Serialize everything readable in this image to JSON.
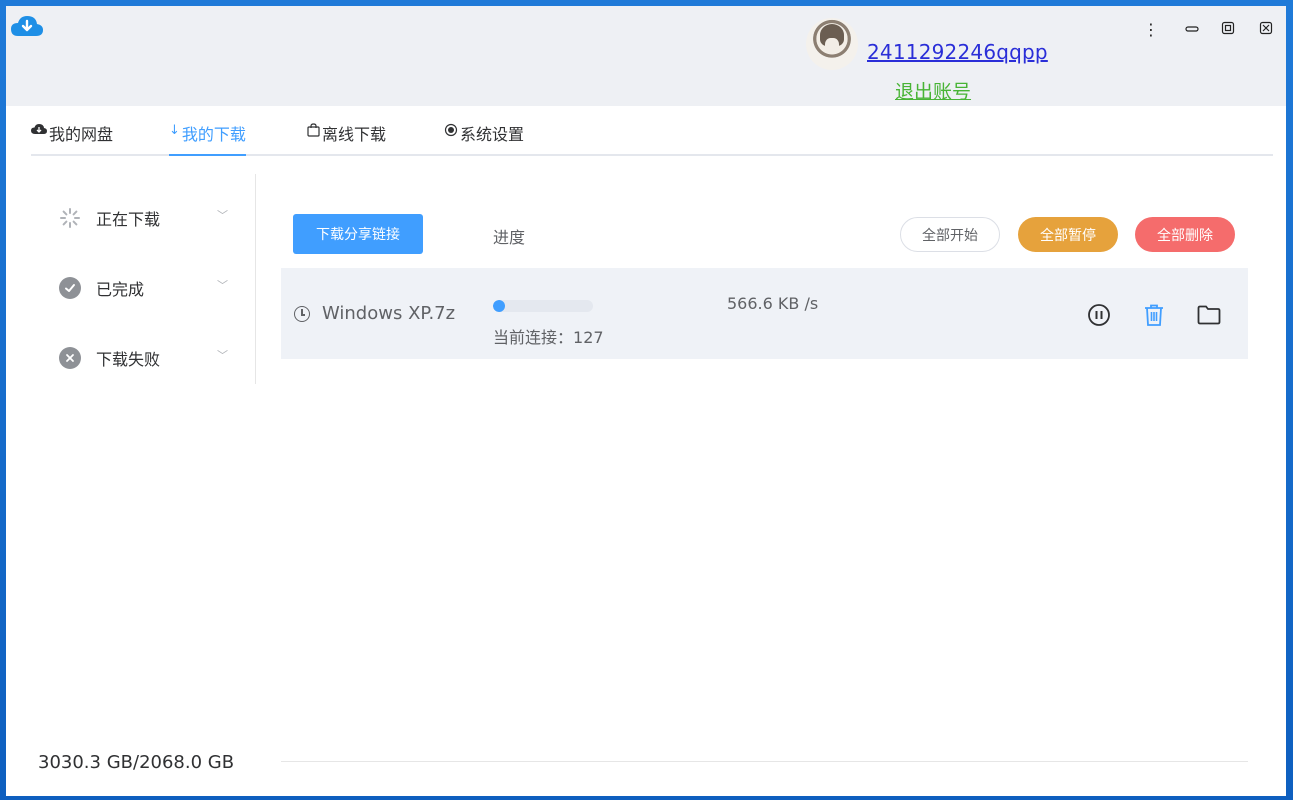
{
  "titlebar": {
    "username": "2411292246qqpp",
    "logout_label": "退出账号",
    "menu_glyph": "⋮",
    "minimize_glyph": "▭",
    "maximize_glyph": "◙",
    "close_glyph": "⛝"
  },
  "tabs": [
    {
      "icon": "cloud-icon",
      "label": "我的网盘",
      "active": false
    },
    {
      "icon": "download-icon",
      "label": "我的下载",
      "active": true
    },
    {
      "icon": "offline-bag-icon",
      "label": "离线下载",
      "active": false
    },
    {
      "icon": "settings-radio-icon",
      "label": "系统设置",
      "active": false
    }
  ],
  "sidebar": {
    "items": [
      {
        "icon": "spinner-icon",
        "label": "正在下载"
      },
      {
        "icon": "check-circle-icon",
        "label": "已完成"
      },
      {
        "icon": "close-circle-icon",
        "label": "下载失败"
      }
    ]
  },
  "toolbar": {
    "share_label": "下载分享链接",
    "progress_header": "进度",
    "start_all": "全部开始",
    "pause_all": "全部暂停",
    "delete_all": "全部删除"
  },
  "downloads": [
    {
      "name": "Windows XP.7z",
      "progress": 0.05,
      "connections_label": "当前连接：",
      "connections": "127",
      "speed": "566.6 KB /s"
    }
  ],
  "footer": {
    "storage": "3030.3 GB/2068.0 GB"
  },
  "colors": {
    "accent": "#409eff",
    "pause": "#e6a23c",
    "delete": "#f56c6c",
    "username_link": "#2a2ed8",
    "logout_link": "#48b435"
  }
}
